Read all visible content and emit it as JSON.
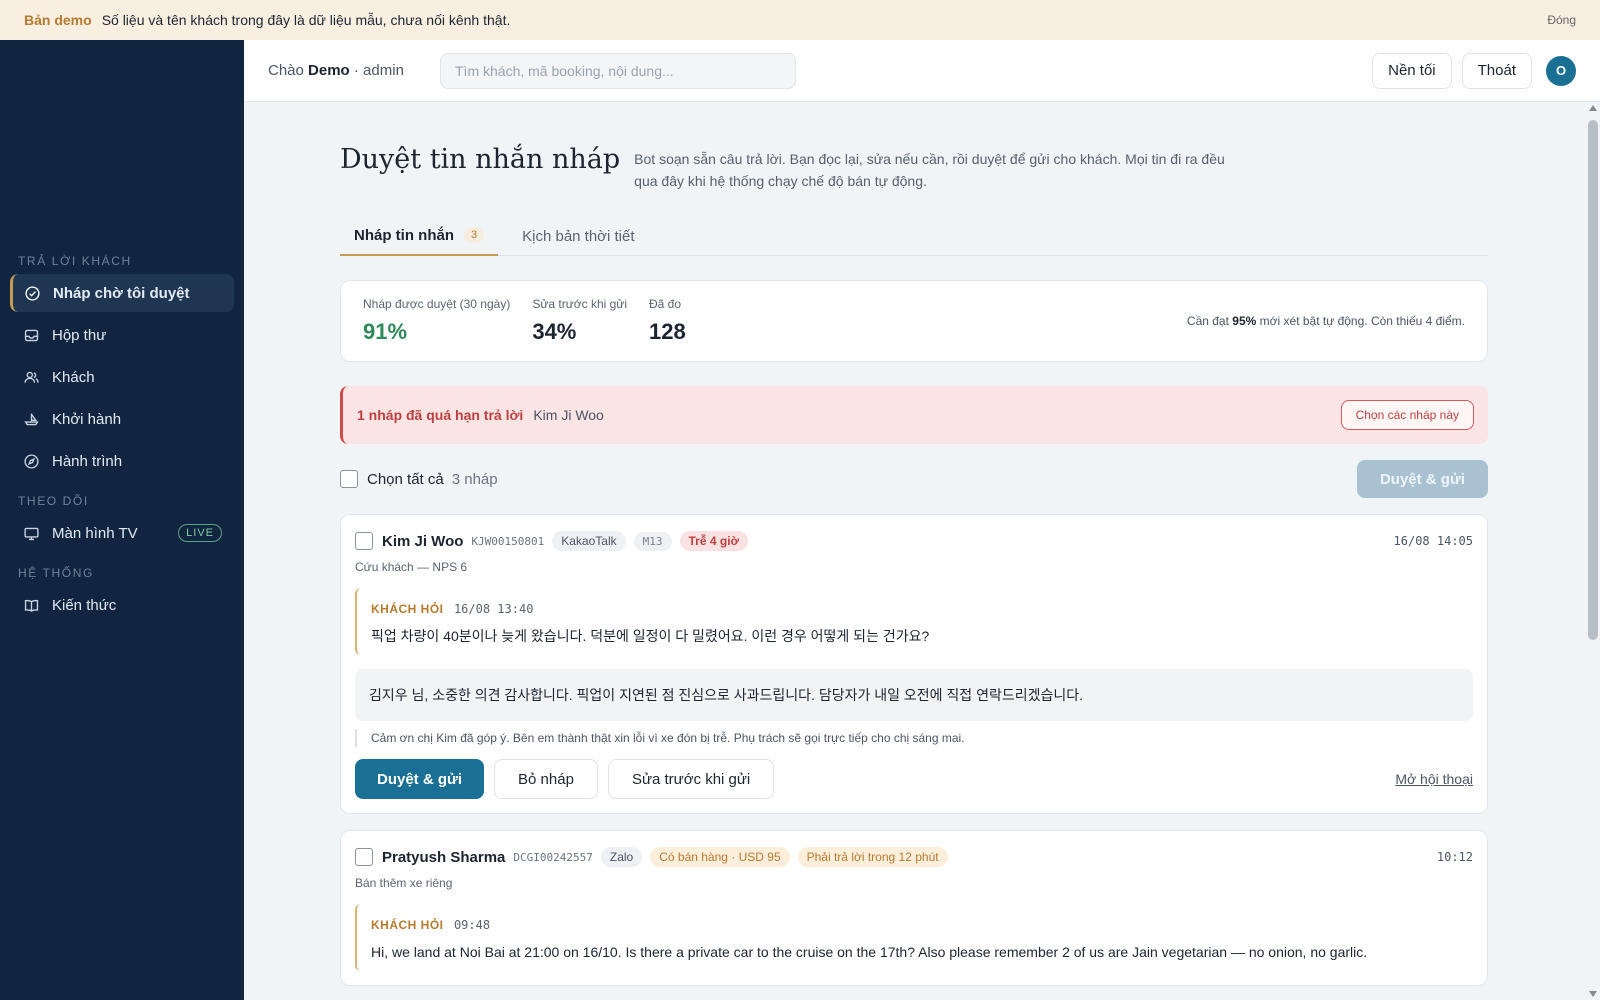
{
  "banner": {
    "tag": "Bản demo",
    "message": "Số liệu và tên khách trong đây là dữ liệu mẫu, chưa nối kênh thật.",
    "close_label": "Đóng"
  },
  "sidebar": {
    "sections": [
      {
        "title": "TRẢ LỜI KHÁCH",
        "items": [
          {
            "label": "Nháp chờ tôi duyệt",
            "icon": "check-circle-icon",
            "active": true
          },
          {
            "label": "Hộp thư",
            "icon": "inbox-icon"
          },
          {
            "label": "Khách",
            "icon": "users-icon"
          },
          {
            "label": "Khởi hành",
            "icon": "boat-icon"
          },
          {
            "label": "Hành trình",
            "icon": "compass-icon"
          }
        ]
      },
      {
        "title": "THEO DÕI",
        "items": [
          {
            "label": "Màn hình TV",
            "icon": "monitor-icon",
            "badge": "LIVE"
          }
        ]
      },
      {
        "title": "HỆ THỐNG",
        "items": [
          {
            "label": "Kiến thức",
            "icon": "book-icon"
          }
        ]
      }
    ]
  },
  "topbar": {
    "greeting_prefix": "Chào",
    "user_name": "Demo",
    "user_role": "· admin",
    "search_placeholder": "Tìm khách, mã booking, nội dung...",
    "dark_mode_label": "Nền tối",
    "logout_label": "Thoát",
    "avatar_initial": "O"
  },
  "page": {
    "title": "Duyệt tin nhắn nháp",
    "description": "Bot soạn sẵn câu trả lời. Bạn đọc lại, sửa nếu cần, rồi duyệt để gửi cho khách. Mọi tin đi ra đều qua đây khi hệ thống chạy chế độ bán tự động."
  },
  "tabs": [
    {
      "label": "Nháp tin nhắn",
      "count": "3",
      "active": true
    },
    {
      "label": "Kịch bản thời tiết"
    }
  ],
  "stats": {
    "items": [
      {
        "label": "Nháp được duyệt (30 ngày)",
        "value": "91%"
      },
      {
        "label": "Sửa trước khi gửi",
        "value": "34%"
      },
      {
        "label": "Đã đo",
        "value": "128"
      }
    ],
    "note_prefix": "Cần đạt",
    "note_bold": "95%",
    "note_suffix": "mới xét bật tự động. Còn thiếu 4 điểm."
  },
  "alert": {
    "text": "1 nháp đã quá hạn trả lời",
    "who": "Kim Ji Woo",
    "button": "Chọn các nháp này"
  },
  "selection": {
    "select_all_label": "Chọn tất cả",
    "count_label": "3 nháp",
    "approve_all_label": "Duyệt & gửi"
  },
  "drafts": [
    {
      "name": "Kim Ji Woo",
      "booking": "KJW00150801",
      "channel": "KakaoTalk",
      "tag": "M13",
      "status": "Trễ 4 giờ",
      "time": "16/08 14:05",
      "subtitle": "Cứu khách — NPS 6",
      "question_label": "KHÁCH HỎI",
      "question_time": "16/08 13:40",
      "question": "픽업 차량이 40분이나 늦게 왔습니다. 덕분에 일정이 다 밀렸어요. 이런 경우 어떻게 되는 건가요?",
      "reply": "김지우 님, 소중한 의견 감사합니다. 픽업이 지연된 점 진심으로 사과드립니다. 담당자가 내일 오전에 직접 연락드리겠습니다.",
      "translation": "Cảm ơn chị Kim đã góp ý. Bên em thành thật xin lỗi vì xe đón bị trễ. Phụ trách sẽ gọi trực tiếp cho chị sáng mai.",
      "approve_label": "Duyệt & gửi",
      "discard_label": "Bỏ nháp",
      "edit_label": "Sửa trước khi gửi",
      "open_label": "Mở hội thoại"
    },
    {
      "name": "Pratyush Sharma",
      "booking": "DCGI00242557",
      "channel": "Zalo",
      "sale_pill": "Có bán hàng · USD 95",
      "status": "Phải trả lời trong 12 phút",
      "time": "10:12",
      "subtitle": "Bán thêm xe riêng",
      "question_label": "KHÁCH HỎI",
      "question_time": "09:48",
      "question": "Hi, we land at Noi Bai at 21:00 on 16/10. Is there a private car to the cruise on the 17th? Also please remember 2 of us are Jain vegetarian — no onion, no garlic."
    }
  ],
  "colors": {
    "sidebar_bg": "#112540",
    "accent_gold": "#c89a52",
    "primary_blue": "#1a6f95",
    "alert_red": "#c03f3f",
    "success_green": "#2e8a58"
  }
}
